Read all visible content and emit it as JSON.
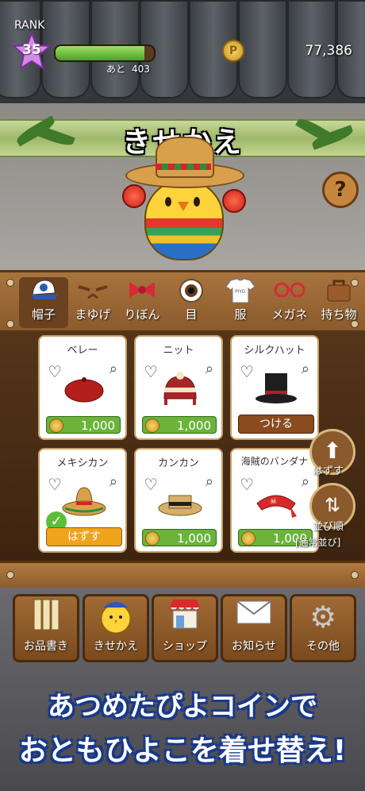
{
  "header": {
    "rank_label": "RANK",
    "rank_value": "35",
    "xp_progress": 0.9,
    "xp_next_label": "あと",
    "xp_next_value": "403",
    "coin_count": "77,386",
    "screen_title": "きせかえ",
    "help_label": "?"
  },
  "tabs": [
    {
      "label": "帽子",
      "icon": "cap-icon",
      "active": true
    },
    {
      "label": "まゆげ",
      "icon": "eyebrows-icon",
      "active": false
    },
    {
      "label": "りぼん",
      "icon": "ribbon-icon",
      "active": false
    },
    {
      "label": "目",
      "icon": "eye-icon",
      "active": false
    },
    {
      "label": "服",
      "icon": "shirt-icon",
      "active": false
    },
    {
      "label": "メガネ",
      "icon": "glasses-icon",
      "active": false
    },
    {
      "label": "持ち物",
      "icon": "bag-icon",
      "active": false
    }
  ],
  "items": [
    {
      "name": "ベレー",
      "price": "1,000",
      "state": "buy",
      "color": "#b3201c"
    },
    {
      "name": "ニット",
      "price": "1,000",
      "state": "buy",
      "color": "#a8262a"
    },
    {
      "name": "シルクハット",
      "action": "つける",
      "state": "equip",
      "color": "#1e1e1e"
    },
    {
      "name": "メキシカン",
      "action": "はずす",
      "state": "equipped",
      "color": "#d9a04c"
    },
    {
      "name": "カンカン",
      "price": "1,000",
      "state": "buy",
      "color": "#d6b06a"
    },
    {
      "name": "海賊のバンダナ",
      "price": "1,000",
      "state": "buy",
      "color": "#d62a2a"
    }
  ],
  "side_buttons": {
    "remove_label": "はずす",
    "sort_label": "並び順",
    "sort_value": "[通常並び]"
  },
  "bottom_menu": [
    {
      "label": "お品書き",
      "icon": "menu-scroll-icon"
    },
    {
      "label": "きせかえ",
      "icon": "chick-icon"
    },
    {
      "label": "ショップ",
      "icon": "shop-icon"
    },
    {
      "label": "お知らせ",
      "icon": "envelope-icon"
    },
    {
      "label": "その他",
      "icon": "gear-icon"
    }
  ],
  "promo": {
    "line1": "あつめたぴよコインで",
    "line2": "おともひよこを着せ替え!"
  },
  "colors": {
    "accent_green": "#6bb33a",
    "wood": "#8a5a2c",
    "promo_outline": "#1a3a8a"
  }
}
